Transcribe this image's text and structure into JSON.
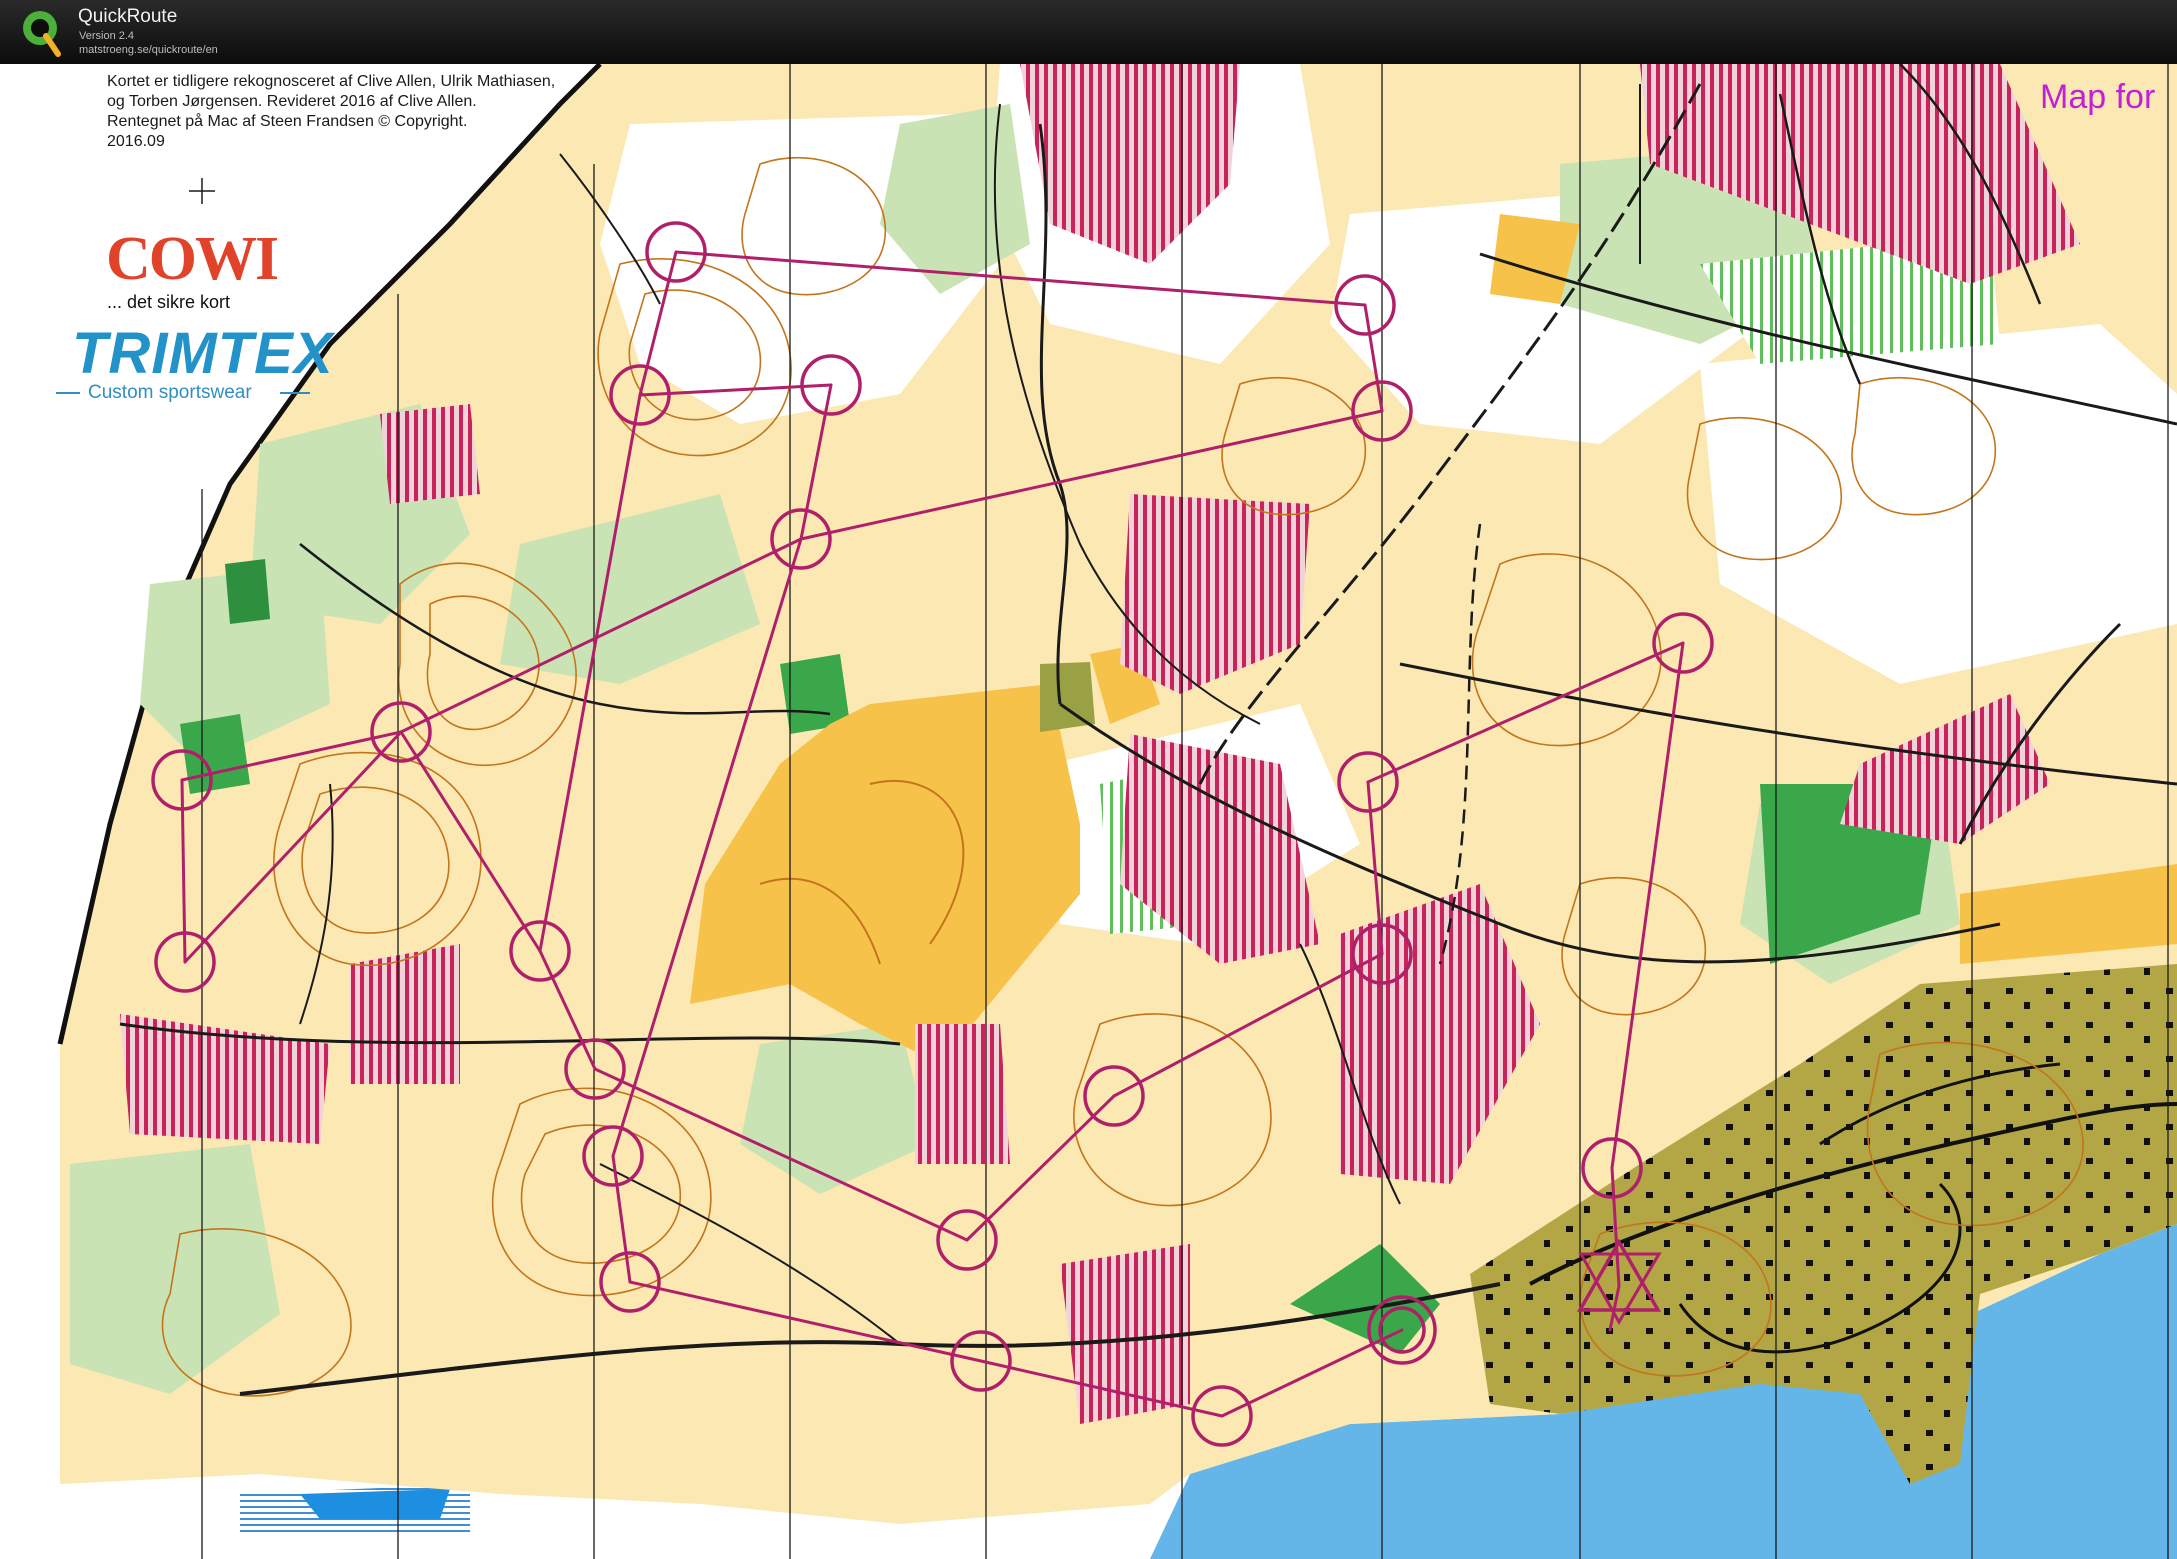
{
  "app": {
    "title": "QuickRoute",
    "version": "Version 2.4",
    "url": "matstroeng.se/quickroute/en"
  },
  "map": {
    "credits": [
      "Kortet er tidligere rekognosceret af Clive Allen, Ulrik Mathiasen,",
      "og Torben Jørgensen. Revideret 2016 af Clive Allen.",
      "Rentegnet på Mac af Steen Frandsen    © Copyright.",
      "2016.09"
    ],
    "sponsors": {
      "cowi_logo": "COWI",
      "cowi_tagline": "... det sikre kort",
      "trimtex_logo": "TRIMTEX",
      "trimtex_tagline": "Custom sportswear"
    },
    "corner_label": "Map for",
    "colors": {
      "open_land": "#f7c24a",
      "rough_open": "#fbe8b3",
      "forest_green_light": "#c9e3b4",
      "forest_green_dark": "#3aa84a",
      "contour": "#c4751b",
      "settlement": "#b2a645",
      "water": "#65b6e8",
      "course_magenta": "#b0206a",
      "out_of_bounds": "#c8245a",
      "track": "#1a1a1a"
    }
  }
}
